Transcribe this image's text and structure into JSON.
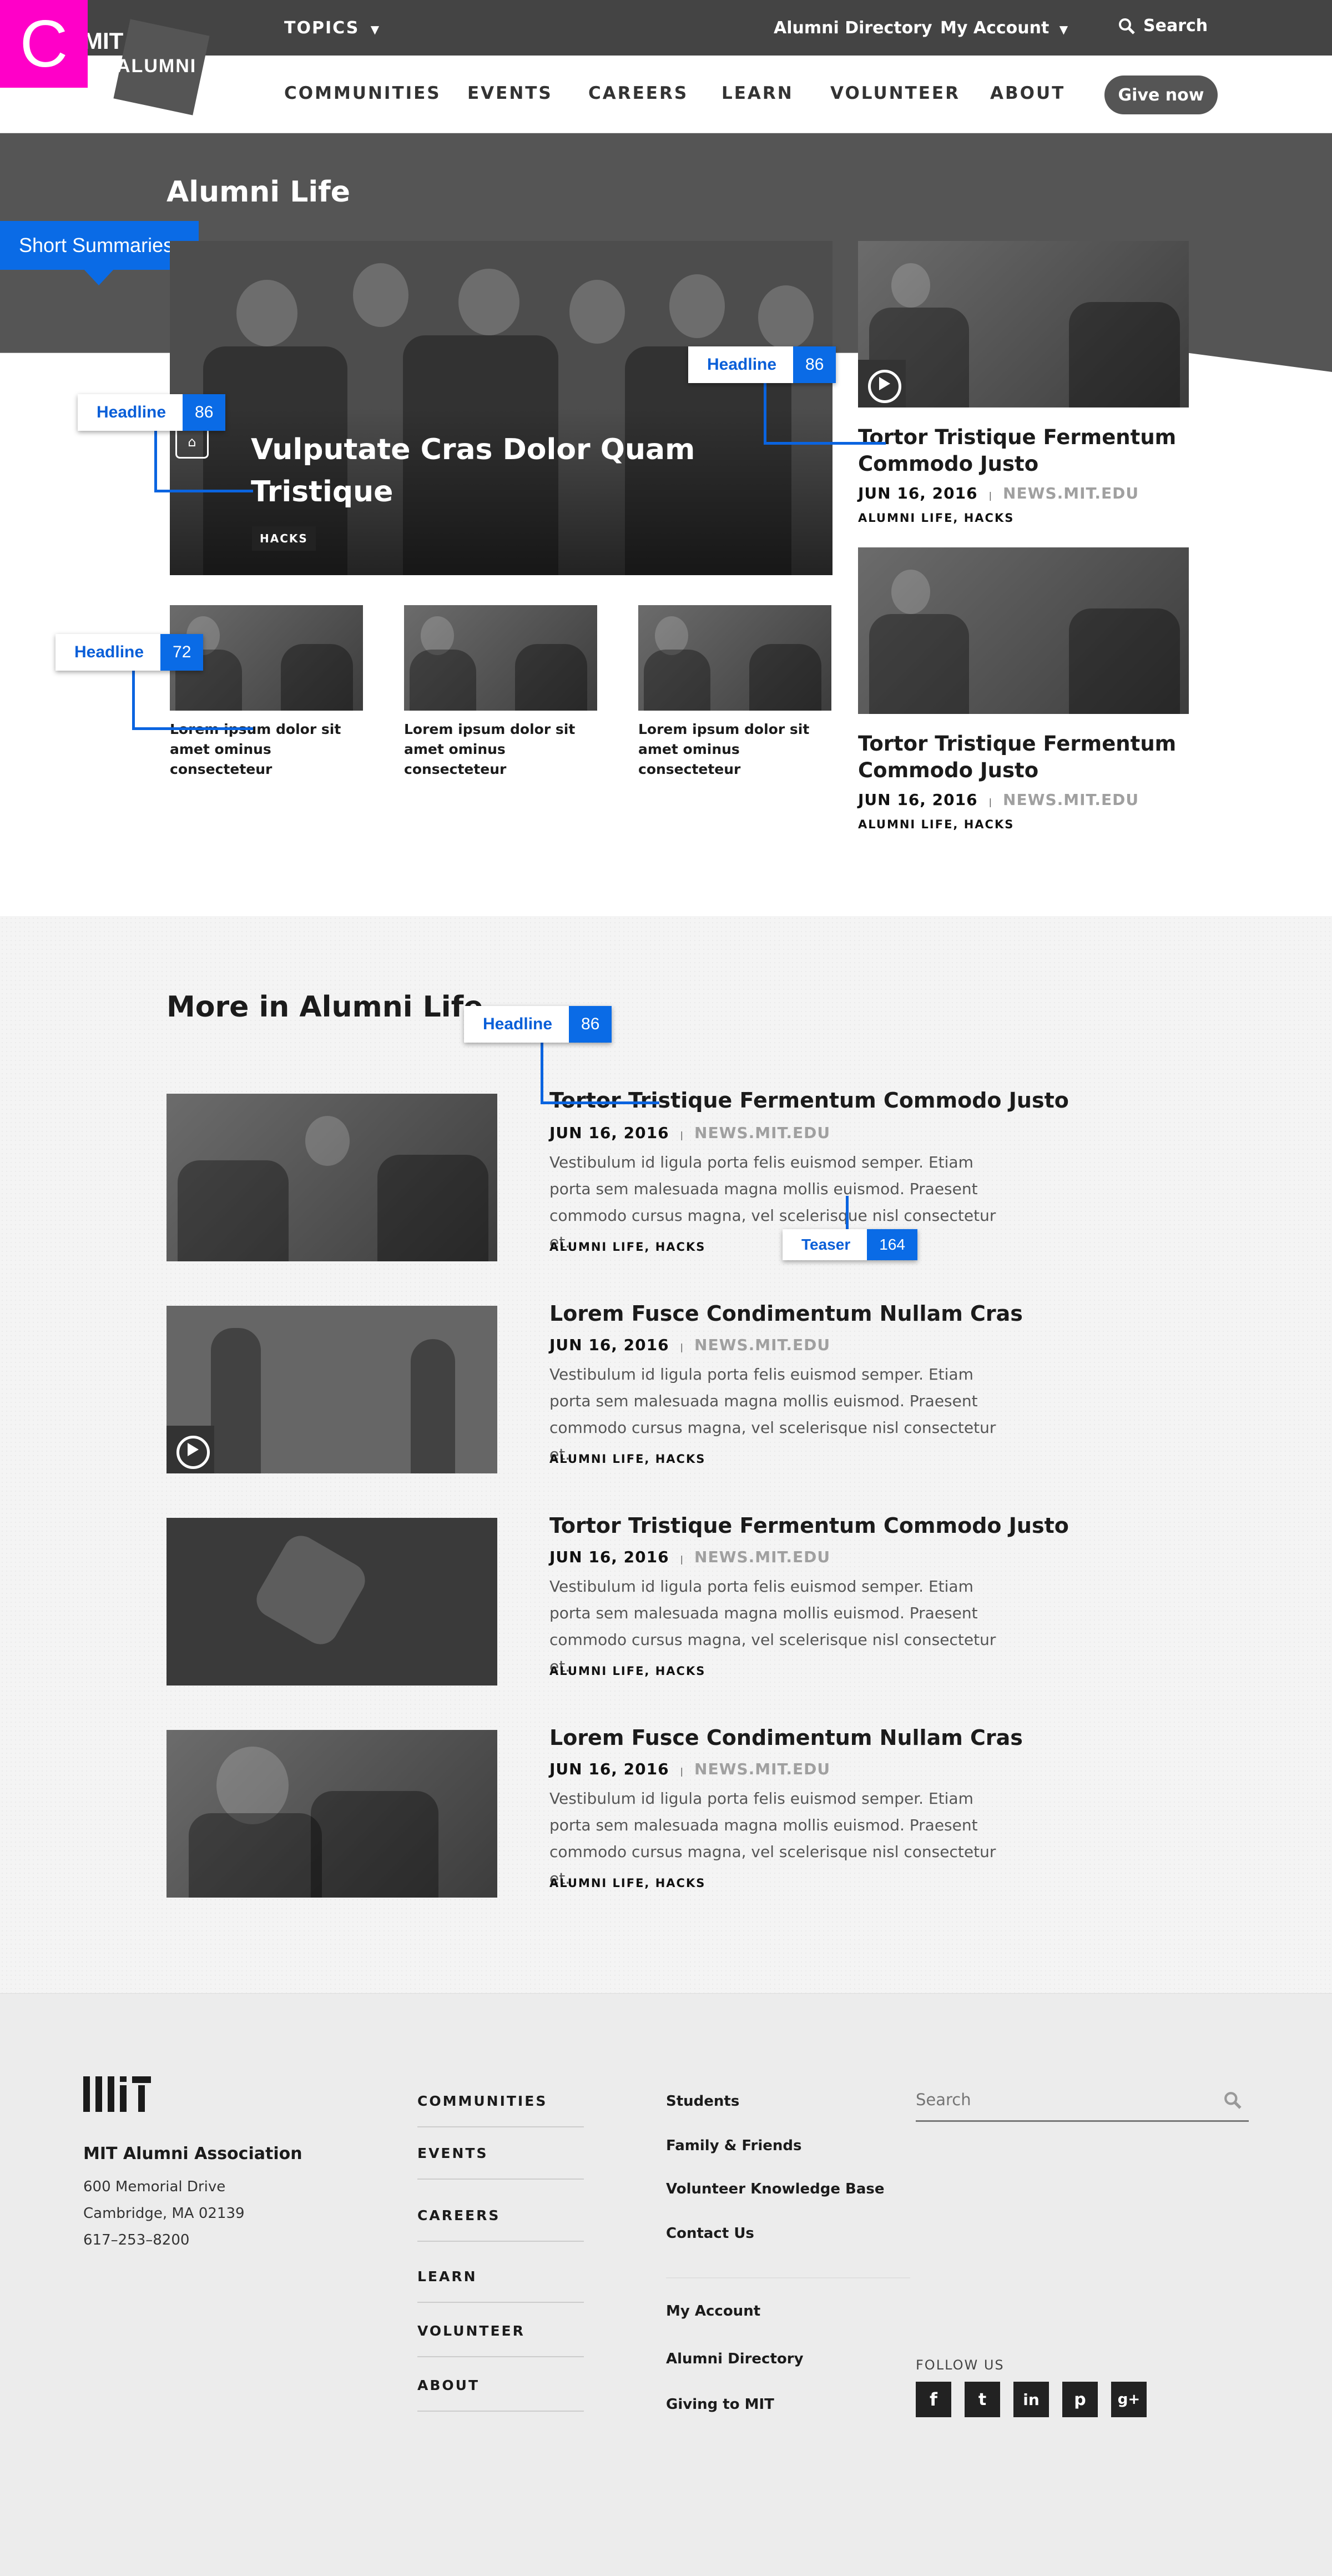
{
  "badge": "C",
  "logo": {
    "mit": "MIT",
    "alumni": "ALUMNI"
  },
  "topbar": {
    "topics": "TOPICS",
    "directory": "Alumni Directory",
    "account": "My Account",
    "search": "Search"
  },
  "nav": {
    "items": [
      "COMMUNITIES",
      "EVENTS",
      "CAREERS",
      "LEARN",
      "VOLUNTEER",
      "ABOUT"
    ],
    "give": "Give now"
  },
  "hero": {
    "title": "Alumni Life",
    "tab": "Short Summaries"
  },
  "feature": {
    "headline": "Vulputate Cras Dolor Quam Tristique",
    "tag": "HACKS"
  },
  "small_cards": [
    {
      "text": "Lorem ipsum dolor sit amet ominus consecteteur"
    },
    {
      "text": "Lorem ipsum dolor sit amet ominus consecteteur"
    },
    {
      "text": "Lorem ipsum dolor sit amet ominus consecteteur"
    }
  ],
  "side_cards": [
    {
      "headline": "Tortor Tristique Fermentum Commodo Justo",
      "date": "JUN 16, 2016",
      "source": "NEWS.MIT.EDU",
      "tags": "ALUMNI LIFE, HACKS"
    },
    {
      "headline": "Tortor Tristique Fermentum Commodo Justo",
      "date": "JUN 16, 2016",
      "source": "NEWS.MIT.EDU",
      "tags": "ALUMNI LIFE, HACKS"
    }
  ],
  "more": {
    "title": "More in Alumni Life",
    "items": [
      {
        "headline": "Tortor Tristique Fermentum Commodo Justo",
        "date": "JUN 16, 2016",
        "source": "NEWS.MIT.EDU",
        "teaser": "Vestibulum id ligula porta felis euismod semper. Etiam porta sem malesuada magna mollis euismod. Praesent commodo cursus magna, vel scelerisque nisl consectetur et.",
        "tags": "ALUMNI LIFE, HACKS"
      },
      {
        "headline": "Lorem Fusce Condimentum Nullam Cras",
        "date": "JUN 16, 2016",
        "source": "NEWS.MIT.EDU",
        "teaser": "Vestibulum id ligula porta felis euismod semper. Etiam porta sem malesuada magna mollis euismod. Praesent commodo cursus magna, vel scelerisque nisl consectetur et.",
        "tags": "ALUMNI LIFE, HACKS"
      },
      {
        "headline": "Tortor Tristique Fermentum Commodo Justo",
        "date": "JUN 16, 2016",
        "source": "NEWS.MIT.EDU",
        "teaser": "Vestibulum id ligula porta felis euismod semper. Etiam porta sem malesuada magna mollis euismod. Praesent commodo cursus magna, vel scelerisque nisl consectetur et.",
        "tags": "ALUMNI LIFE, HACKS"
      },
      {
        "headline": "Lorem Fusce Condimentum Nullam Cras",
        "date": "JUN 16, 2016",
        "source": "NEWS.MIT.EDU",
        "teaser": "Vestibulum id ligula porta felis euismod semper. Etiam porta sem malesuada magna mollis euismod. Praesent commodo cursus magna, vel scelerisque nisl consectetur et.",
        "tags": "ALUMNI LIFE, HACKS"
      }
    ]
  },
  "annotations": {
    "feature_headline": {
      "label": "Headline",
      "count": "86"
    },
    "side_headline": {
      "label": "Headline",
      "count": "86"
    },
    "small_headline": {
      "label": "Headline",
      "count": "72"
    },
    "more_headline": {
      "label": "Headline",
      "count": "86"
    },
    "teaser": {
      "label": "Teaser",
      "count": "164"
    }
  },
  "footer": {
    "org": "MIT Alumni Association",
    "address1": "600 Memorial Drive",
    "address2": "Cambridge, MA 02139",
    "phone": "617–253–8200",
    "nav1": [
      "COMMUNITIES",
      "EVENTS",
      "CAREERS",
      "LEARN",
      "VOLUNTEER",
      "ABOUT"
    ],
    "nav2": [
      "Students",
      "Family & Friends",
      "Volunteer Knowledge Base",
      "Contact Us"
    ],
    "nav3": [
      "My Account",
      "Alumni Directory",
      "Giving to MIT"
    ],
    "search_placeholder": "Search",
    "follow": "FOLLOW US",
    "social": [
      "f",
      "t",
      "in",
      "p",
      "g+"
    ]
  },
  "colors": {
    "accent": "#0a6be6",
    "badge": "#ff00c8",
    "dark": "#4a4a4a"
  }
}
